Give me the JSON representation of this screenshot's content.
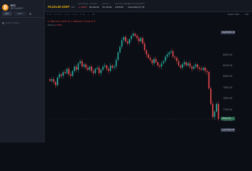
{
  "sidebar": {
    "brand": {
      "name": "BTC",
      "pair": "BTC/USDT",
      "coin_glyph": "₿",
      "coin_color": "#f7931a"
    },
    "tabs": [
      "ALL",
      "USDT"
    ],
    "tab_icon": "filter-icon",
    "search_placeholder": "Search market"
  },
  "header": {
    "price": "76,124.49 USDT",
    "price_sub": "+1d",
    "stats": [
      {
        "label": "24h Change",
        "value": "-2.1800%",
        "negative": true
      },
      {
        "label": "24h High",
        "value": "80,224.00",
        "negative": false
      },
      {
        "label": "24h Low",
        "value": "76,701.00",
        "negative": false
      },
      {
        "label": "24h Volume(BTC)",
        "value": "4,978.55",
        "negative": false
      },
      {
        "label": "24h Turnover(USDT)",
        "value": "4,016,000,177.78",
        "negative": false
      }
    ],
    "menu_icon": "more-vertical-icon"
  },
  "toolbar": {
    "left_tools": "1m 15m 1H 4H 1D ~ ⚙",
    "right_items": [
      "Depth Chart",
      "Full"
    ]
  },
  "chart_data": {
    "type": "candlestick",
    "legend_ohlc": "O 79697.30  H 79757.87  L 79680.00  C 79719.11  ▼",
    "legend_vol_label": "Volume",
    "legend_vol_value": "1.4979",
    "y_ticks": [
      "84000.00",
      "82000.00",
      "81000.00",
      "80000.00",
      "79000.00",
      "78000.00",
      "77000.00",
      "76000.00",
      "75000.00"
    ],
    "high_tag": {
      "label": "High",
      "value": "84001.00"
    },
    "low_tag": {
      "label": "Low",
      "value": "75110.75"
    },
    "last_tag": "76124.49",
    "up_color": "#26a69a",
    "down_color": "#e5484d",
    "ylim": [
      74500,
      84500
    ],
    "closes": [
      79600,
      79750,
      79500,
      79200,
      79900,
      80200,
      80050,
      80400,
      80300,
      80700,
      80200,
      80050,
      80500,
      80900,
      80600,
      81200,
      81400,
      80900,
      81100,
      80800,
      80600,
      80900,
      80500,
      80300,
      80700,
      80800,
      80300,
      80600,
      80900,
      81000,
      80700,
      80500,
      81000,
      80800,
      80900,
      81500,
      82200,
      82700,
      83300,
      83600,
      83200,
      83000,
      83400,
      83700,
      83900,
      83700,
      83500,
      83200,
      83500,
      83000,
      82400,
      82000,
      81700,
      81500,
      81200,
      81600,
      81300,
      81000,
      80900,
      81200,
      81400,
      81800,
      82000,
      82200,
      82300,
      81800,
      81700,
      81400,
      81000,
      80800,
      81100,
      81300,
      81000,
      81200,
      80900,
      80700,
      80900,
      81100,
      80800,
      80700,
      80600,
      80800,
      80500,
      80400,
      78900,
      77500,
      76300,
      76800,
      77500,
      76124
    ]
  }
}
